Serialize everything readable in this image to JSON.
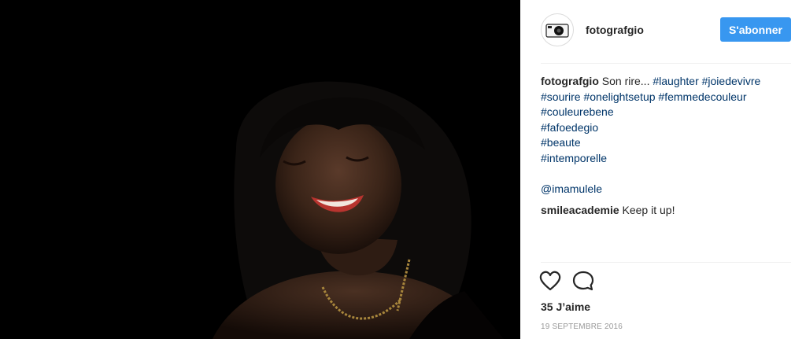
{
  "post": {
    "username": "fotografgio",
    "follow_label": "S'abonner",
    "caption": {
      "username": "fotografgio",
      "text": "Son rire...",
      "tags_line1": "#laughter #joiedevivre",
      "tags_line2": "#sourire #onelightsetup #femmedecouleur",
      "tags_line3": "#couleurebene",
      "tags_line4": "#fafoedegio",
      "tags_line5": "#beaute",
      "tags_line6": "#intemporelle"
    },
    "mention": "@imamulele",
    "comment": {
      "username": "smileacademie",
      "text": "Keep it up!"
    },
    "likes": "35 J’aime",
    "date": "19 SEPTEMBRE 2016",
    "icons": {
      "like": "heart-icon",
      "comment": "comment-bubble-icon",
      "avatar": "camera-icon"
    },
    "colors": {
      "follow": "#3897f0",
      "link": "#003569",
      "muted": "#999999"
    }
  }
}
